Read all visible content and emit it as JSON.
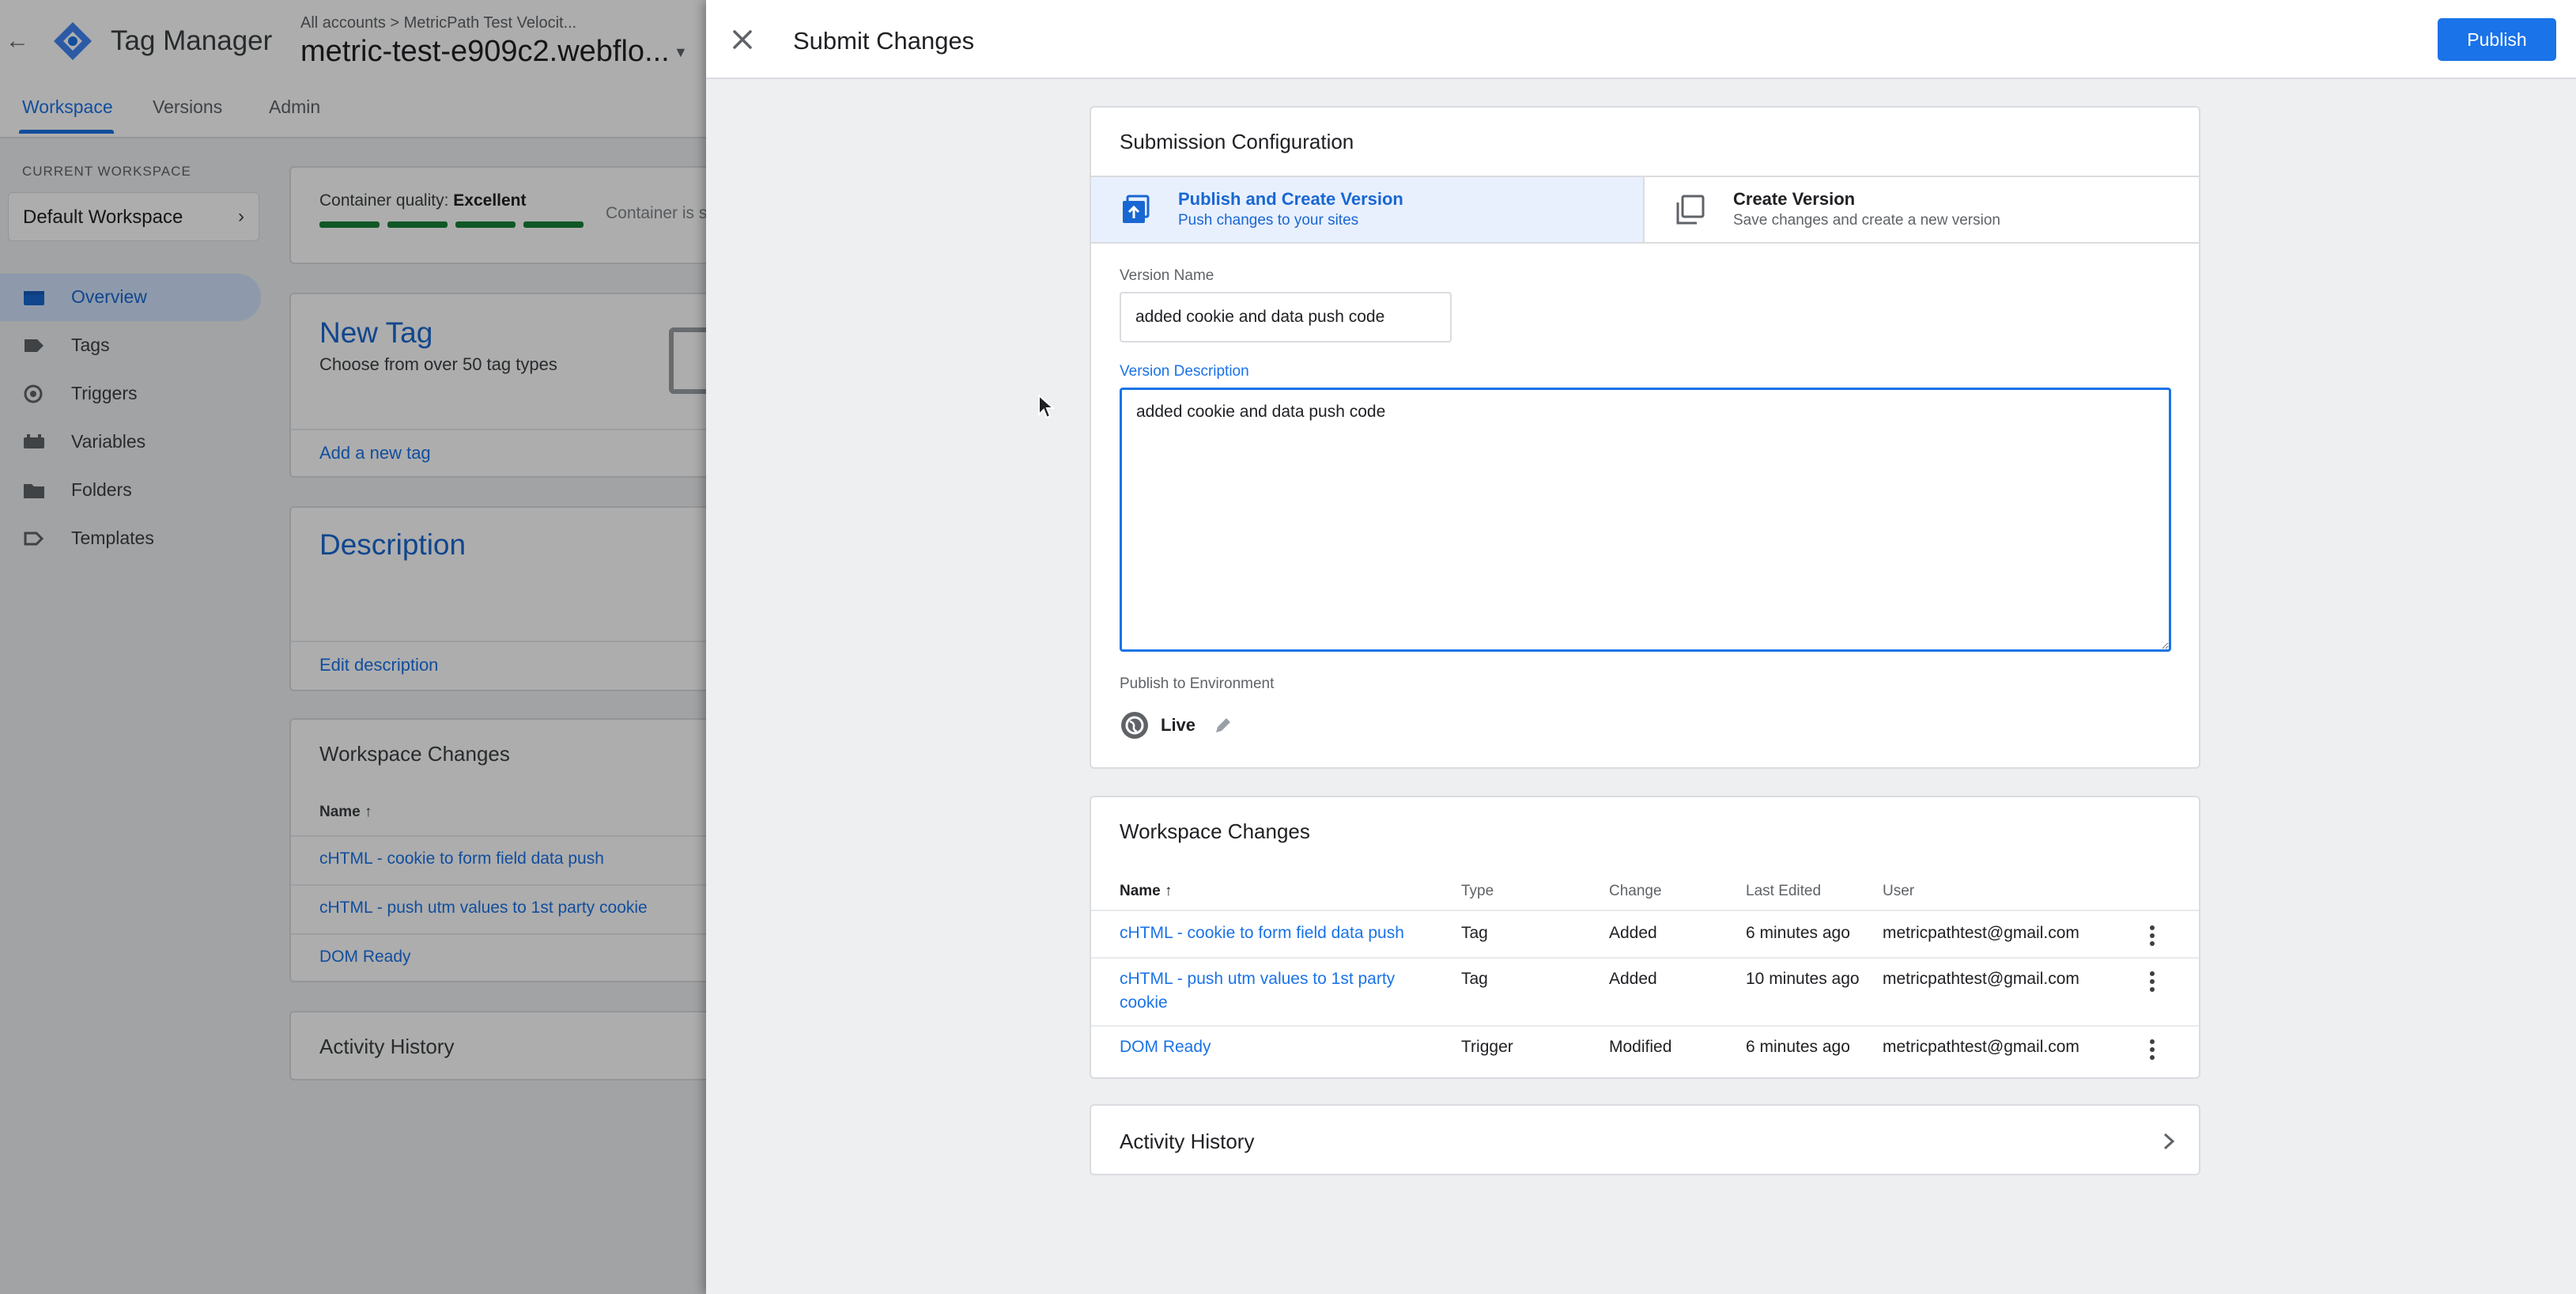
{
  "app": {
    "product_name": "Tag Manager",
    "breadcrumb": "All accounts > MetricPath Test Velocit...",
    "container_name": "metric-test-e909c2.webflo...",
    "nav_tabs": [
      "Workspace",
      "Versions",
      "Admin"
    ],
    "current_workspace_label": "CURRENT WORKSPACE",
    "workspace_name": "Default Workspace",
    "sidebar": [
      {
        "label": "Overview",
        "icon": "overview-icon"
      },
      {
        "label": "Tags",
        "icon": "tag-icon"
      },
      {
        "label": "Triggers",
        "icon": "trigger-icon"
      },
      {
        "label": "Variables",
        "icon": "variables-icon"
      },
      {
        "label": "Folders",
        "icon": "folder-icon"
      },
      {
        "label": "Templates",
        "icon": "template-icon"
      }
    ],
    "quality": {
      "label": "Container quality:",
      "value": "Excellent",
      "status_text": "Container is s"
    },
    "new_tag": {
      "title": "New Tag",
      "subtitle": "Choose from over 50 tag types",
      "link": "Add a new tag"
    },
    "description": {
      "title": "Description",
      "link": "Edit description"
    },
    "workspace_changes": {
      "title": "Workspace Changes",
      "name_header": "Name",
      "items": [
        "cHTML - cookie to form field data push",
        "cHTML - push utm values to 1st party cookie",
        "DOM Ready"
      ]
    },
    "activity_history": "Activity History"
  },
  "panel": {
    "title": "Submit Changes",
    "publish_label": "Publish",
    "config": {
      "title": "Submission Configuration",
      "options": [
        {
          "title": "Publish and Create Version",
          "subtitle": "Push changes to your sites"
        },
        {
          "title": "Create Version",
          "subtitle": "Save changes and create a new version"
        }
      ],
      "version_name_label": "Version Name",
      "version_name_value": "added cookie and data push code",
      "version_desc_label": "Version Description",
      "version_desc_value": "added cookie and data push code",
      "env_label": "Publish to Environment",
      "env_name": "Live"
    },
    "changes": {
      "title": "Workspace Changes",
      "headers": {
        "name": "Name",
        "type": "Type",
        "change": "Change",
        "last_edited": "Last Edited",
        "user": "User"
      },
      "rows": [
        {
          "name": "cHTML - cookie to form field data push",
          "type": "Tag",
          "change": "Added",
          "last_edited": "6 minutes ago",
          "user": "metricpathtest@gmail.com"
        },
        {
          "name_line1": "cHTML - push utm values to 1st party",
          "name_line2": "cookie",
          "type": "Tag",
          "change": "Added",
          "last_edited": "10 minutes ago",
          "user": "metricpathtest@gmail.com"
        },
        {
          "name": "DOM Ready",
          "type": "Trigger",
          "change": "Modified",
          "last_edited": "6 minutes ago",
          "user": "metricpathtest@gmail.com"
        }
      ]
    },
    "activity_history": "Activity History"
  },
  "colors": {
    "accent": "#1a73e8",
    "quality_bar": "#188038",
    "selected_bg": "#e8f0fe"
  }
}
